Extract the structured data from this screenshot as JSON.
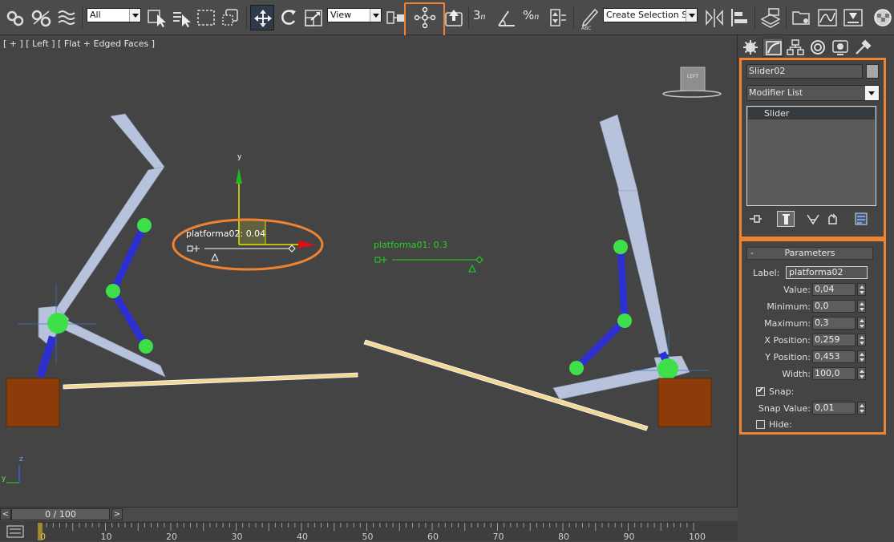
{
  "toolbar": {
    "selection_filter": "All",
    "reference_coord": "View",
    "named_selection_placeholder": "Create Selection Se",
    "snap_label": "3",
    "percent_label": "%"
  },
  "viewport": {
    "label": "[ + ] [ Left ] [ Flat + Edged Faces ]",
    "viewcube_label": "LEFT",
    "gizmo_y_label": "y",
    "axis_z_label": "z",
    "axis_y_label": "y",
    "sliders": [
      {
        "caption": "platforma02:",
        "value_text": "0.04",
        "color": "#ffffff",
        "selected": true
      },
      {
        "caption": "platforma01: 0.3",
        "color": "#21d521",
        "selected": false
      }
    ],
    "colors": {
      "bone": "#b7c3dc",
      "joint": "#3fdf4a",
      "chain": "#2e2fd0",
      "box": "#8b3c09",
      "platform": "#f2d795",
      "highlight": "#f08332"
    }
  },
  "command_panel": {
    "object_name": "Slider02",
    "modifier_list": "Modifier List",
    "stack_items": [
      "Slider"
    ],
    "parameters": {
      "title": "Parameters",
      "collapse_glyph": "-",
      "label_caption": "Label:",
      "label_value": "platforma02",
      "fields": [
        {
          "name": "Value:",
          "value": "0,04"
        },
        {
          "name": "Minimum:",
          "value": "0,0"
        },
        {
          "name": "Maximum:",
          "value": "0,3"
        },
        {
          "name": "X Position:",
          "value": "0,259"
        },
        {
          "name": "Y Position:",
          "value": "0,453"
        },
        {
          "name": "Width:",
          "value": "100,0"
        }
      ],
      "snap_label": "Snap:",
      "snap_checked": true,
      "snap_value_label": "Snap Value:",
      "snap_value": "0,01",
      "hide_label": "Hide:",
      "hide_checked": false
    }
  },
  "timeline": {
    "frame_text": "0 / 100",
    "prev_glyph": "<",
    "next_glyph": ">",
    "ticks": [
      "0",
      "10",
      "20",
      "30",
      "40",
      "50",
      "60",
      "70",
      "80",
      "90",
      "100"
    ]
  }
}
